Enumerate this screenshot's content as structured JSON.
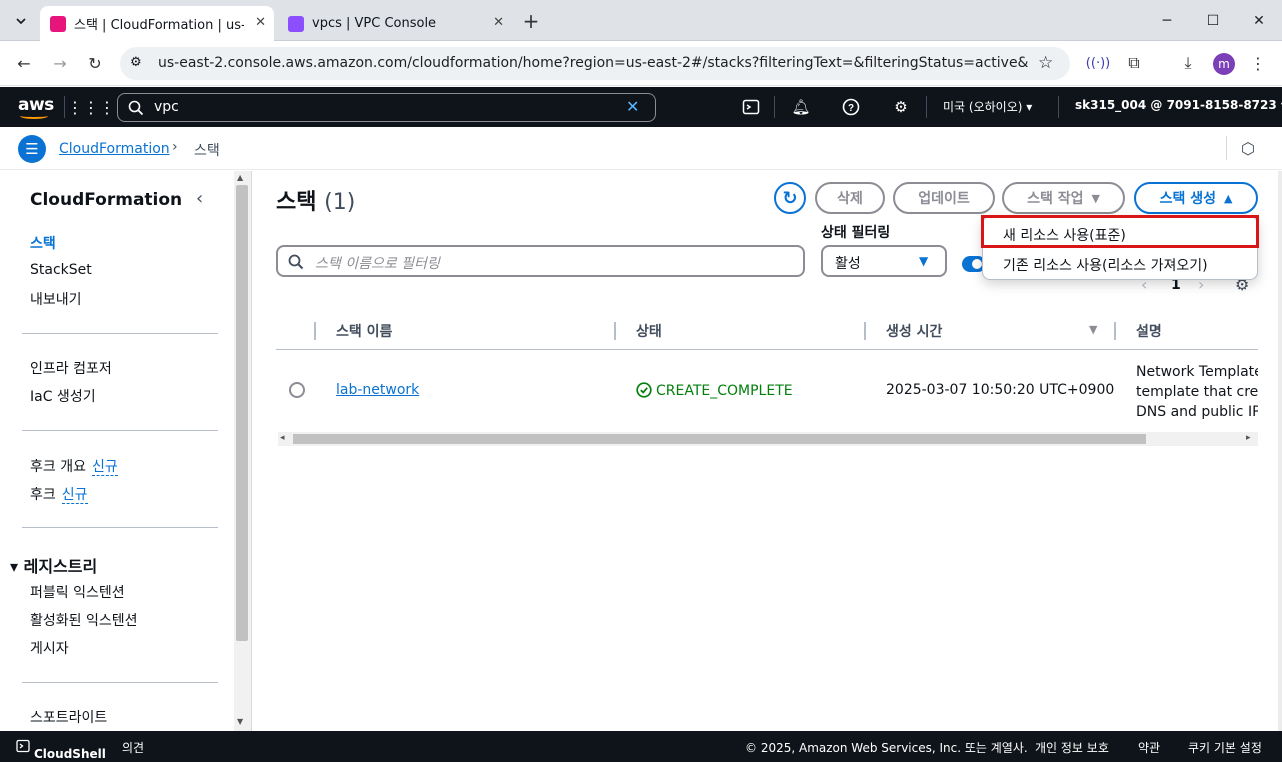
{
  "browser": {
    "tabs": [
      {
        "title": "스택 | CloudFormation | us-ea",
        "active": true
      },
      {
        "title": "vpcs | VPC Console",
        "active": false
      }
    ],
    "new_tab": "+",
    "url": "us-east-2.console.aws.amazon.com/cloudformation/home?region=us-east-2#/stacks?filteringText=&filteringStatus=active&viewNested...",
    "profile_initial": "m"
  },
  "aws_header": {
    "logo": "aws",
    "search_value": "vpc",
    "region": "미국 (오하이오)",
    "account": "sk315_004 @ 7091-8158-8723"
  },
  "breadcrumb": {
    "items": [
      "CloudFormation",
      "스택"
    ],
    "sep": ">"
  },
  "sidebar": {
    "title": "CloudFormation",
    "group1": [
      "스택",
      "StackSet",
      "내보내기"
    ],
    "group2": [
      "인프라 컴포저",
      "IaC 생성기"
    ],
    "group3": [
      {
        "label": "후크 개요",
        "badge": "신규"
      },
      {
        "label": "후크",
        "badge": "신규"
      }
    ],
    "registry": {
      "title": "레지스트리",
      "items": [
        "퍼블릭 익스텐션",
        "활성화된 익스텐션",
        "게시자"
      ]
    },
    "spotlight": "스포트라이트"
  },
  "main": {
    "title": "스택",
    "count": "(1)",
    "buttons": {
      "delete": "삭제",
      "update": "업데이트",
      "stack_actions": "스택 작업",
      "create_stack": "스택 생성"
    },
    "filter": {
      "placeholder": "스택 이름으로 필터링",
      "status_label": "상태 필터링",
      "status_value": "활성"
    },
    "pagination": {
      "page": "1"
    },
    "dropdown": {
      "items": [
        "새 리소스 사용(표준)",
        "기존 리소스 사용(리소스 가져오기)"
      ],
      "highlighted_index": 0
    },
    "table": {
      "headers": [
        "스택 이름",
        "상태",
        "생성 시간",
        "설명"
      ],
      "rows": [
        {
          "name": "lab-network",
          "status": "CREATE_COMPLETE",
          "created": "2025-03-07 10:50:20 UTC+0900",
          "desc_lines": [
            "Network Template:",
            "template that creat",
            "DNS and public IPs"
          ]
        }
      ]
    }
  },
  "footer": {
    "cloudshell": "CloudShell",
    "feedback": "의견",
    "copyright": "© 2025, Amazon Web Services, Inc. 또는 계열사.",
    "privacy": "개인 정보 보호",
    "terms": "약관",
    "cookies": "쿠키 기본 설정"
  },
  "colors": {
    "aws_dark": "#0f141a",
    "link_blue": "#0972d3",
    "success_green": "#037f0c",
    "highlight_red": "#d91515"
  }
}
